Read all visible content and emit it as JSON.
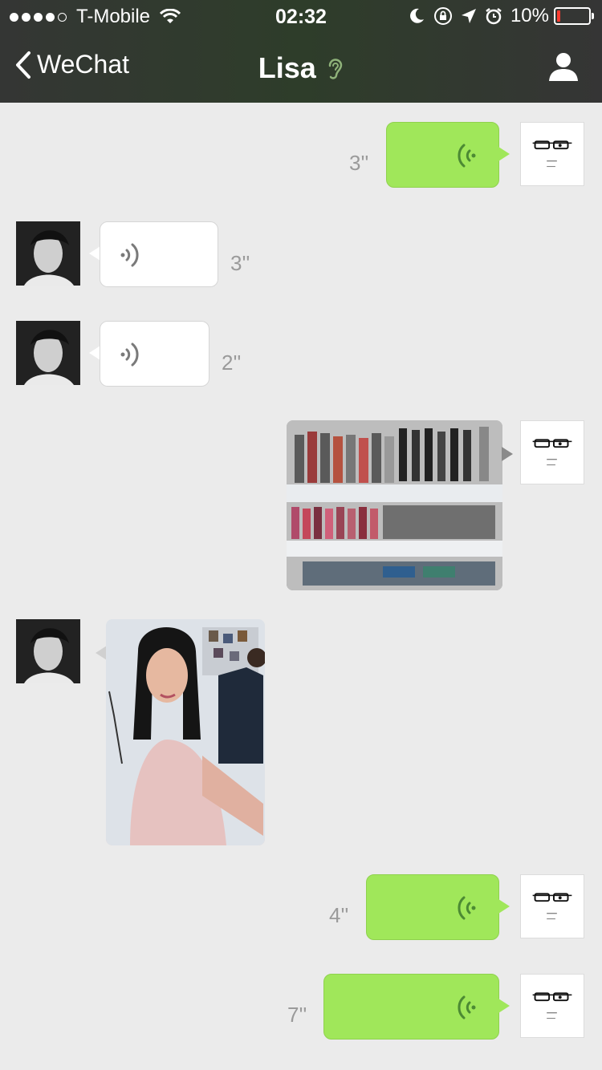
{
  "status_bar": {
    "carrier": "T-Mobile",
    "time": "02:32",
    "battery": "10%",
    "battery_level": 0.1,
    "signal_bars_filled": 4,
    "signal_bars_total": 5
  },
  "nav": {
    "back_label": "WeChat",
    "title": "Lisa"
  },
  "colors": {
    "header": "#2e3d2a",
    "sent_bubble": "#a0e75a",
    "received_bubble": "#ffffff",
    "background": "#ebebeb",
    "voice_sent": "#4c8a33",
    "voice_received": "#7a7a7a"
  },
  "messages": [
    {
      "sender": "me",
      "type": "voice",
      "duration": "3''"
    },
    {
      "sender": "lisa",
      "type": "voice",
      "duration": "3''"
    },
    {
      "sender": "lisa",
      "type": "voice",
      "duration": "2''"
    },
    {
      "sender": "me",
      "type": "image",
      "content": "makeup-shelf-photo"
    },
    {
      "sender": "lisa",
      "type": "image",
      "content": "selfie-photo"
    },
    {
      "sender": "me",
      "type": "voice",
      "duration": "4''"
    },
    {
      "sender": "me",
      "type": "voice",
      "duration": "7''"
    }
  ]
}
